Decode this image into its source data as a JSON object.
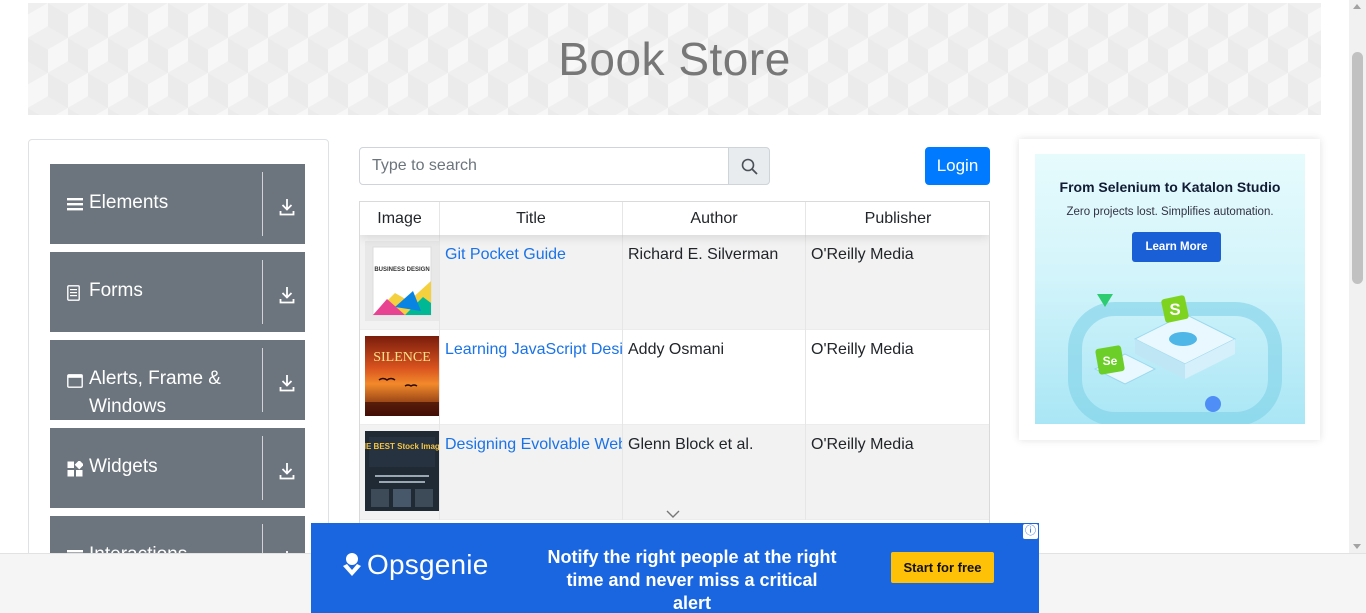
{
  "header": {
    "title": "Book Store"
  },
  "sidebar": {
    "groups": [
      {
        "label": "Elements",
        "icon": "bars-icon"
      },
      {
        "label": "Forms",
        "icon": "document-icon"
      },
      {
        "label": "Alerts, Frame & Windows",
        "icon": "window-icon"
      },
      {
        "label": "Widgets",
        "icon": "widgets-icon"
      },
      {
        "label": "Interactions",
        "icon": "bars-icon"
      }
    ]
  },
  "search": {
    "placeholder": "Type to search",
    "value": ""
  },
  "login": {
    "label": "Login"
  },
  "table": {
    "headers": [
      "Image",
      "Title",
      "Author",
      "Publisher"
    ],
    "rows": [
      {
        "title": "Git Pocket Guide",
        "author": "Richard E. Silverman",
        "publisher": "O'Reilly Media",
        "cover_text": "BUSINESS DESIGN"
      },
      {
        "title": "Learning JavaScript Design Patterns",
        "author": "Addy Osmani",
        "publisher": "O'Reilly Media",
        "cover_text": "SILENCE"
      },
      {
        "title": "Designing Evolvable Web APIs with ASP.NET",
        "author": "Glenn Block et al.",
        "publisher": "O'Reilly Media",
        "cover_text": "THE BEST Stock Images"
      }
    ]
  },
  "side_ad": {
    "title": "From Selenium to Katalon Studio",
    "subtitle": "Zero projects lost. Simplifies automation.",
    "button": "Learn More",
    "badges": [
      "S",
      "Se"
    ]
  },
  "bottom_ad": {
    "brand": "Opsgenie",
    "message": "Notify the right people at the right time and never miss a critical alert",
    "cta": "Start for free",
    "info": "ⓘ"
  },
  "colors": {
    "primary": "#007bff",
    "sidebar_group": "#6c757d",
    "link": "#1a73e8",
    "opsgenie_blue": "#1966e0",
    "cta_yellow": "#ffc107"
  }
}
